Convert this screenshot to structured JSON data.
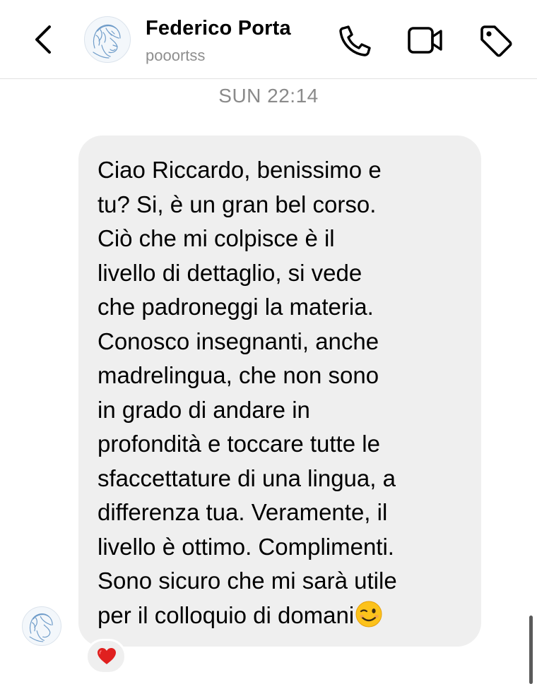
{
  "header": {
    "contact_name": "Federico Porta",
    "handle": "pooortss",
    "icons": {
      "back": "chevron-left-icon",
      "call": "phone-icon",
      "video": "video-camera-icon",
      "tag": "tag-icon"
    }
  },
  "chat": {
    "timestamp": "SUN 22:14",
    "message": {
      "lines": [
        "Ciao Riccardo, benissimo e",
        "tu? Si, è un gran bel corso.",
        "Ciò che mi colpisce è il",
        "livello di dettaglio, si vede",
        "che padroneggi la materia.",
        "Conosco insegnanti, anche",
        "madrelingua, che non sono",
        "in grado di andare in",
        "profondità e toccare tutte le",
        "sfaccettature di una lingua, a",
        "differenza tua. Veramente, il",
        "livello è ottimo. Complimenti.",
        "Sono sicuro che mi sarà utile",
        "per il colloquio di domani"
      ],
      "emoji": "winking-face-emoji",
      "reaction": "red-heart-emoji"
    }
  },
  "colors": {
    "bubble": "#efefef",
    "timestamp": "#8a8a8a",
    "handle": "#8e8e8e",
    "heart": "#e0201f"
  }
}
